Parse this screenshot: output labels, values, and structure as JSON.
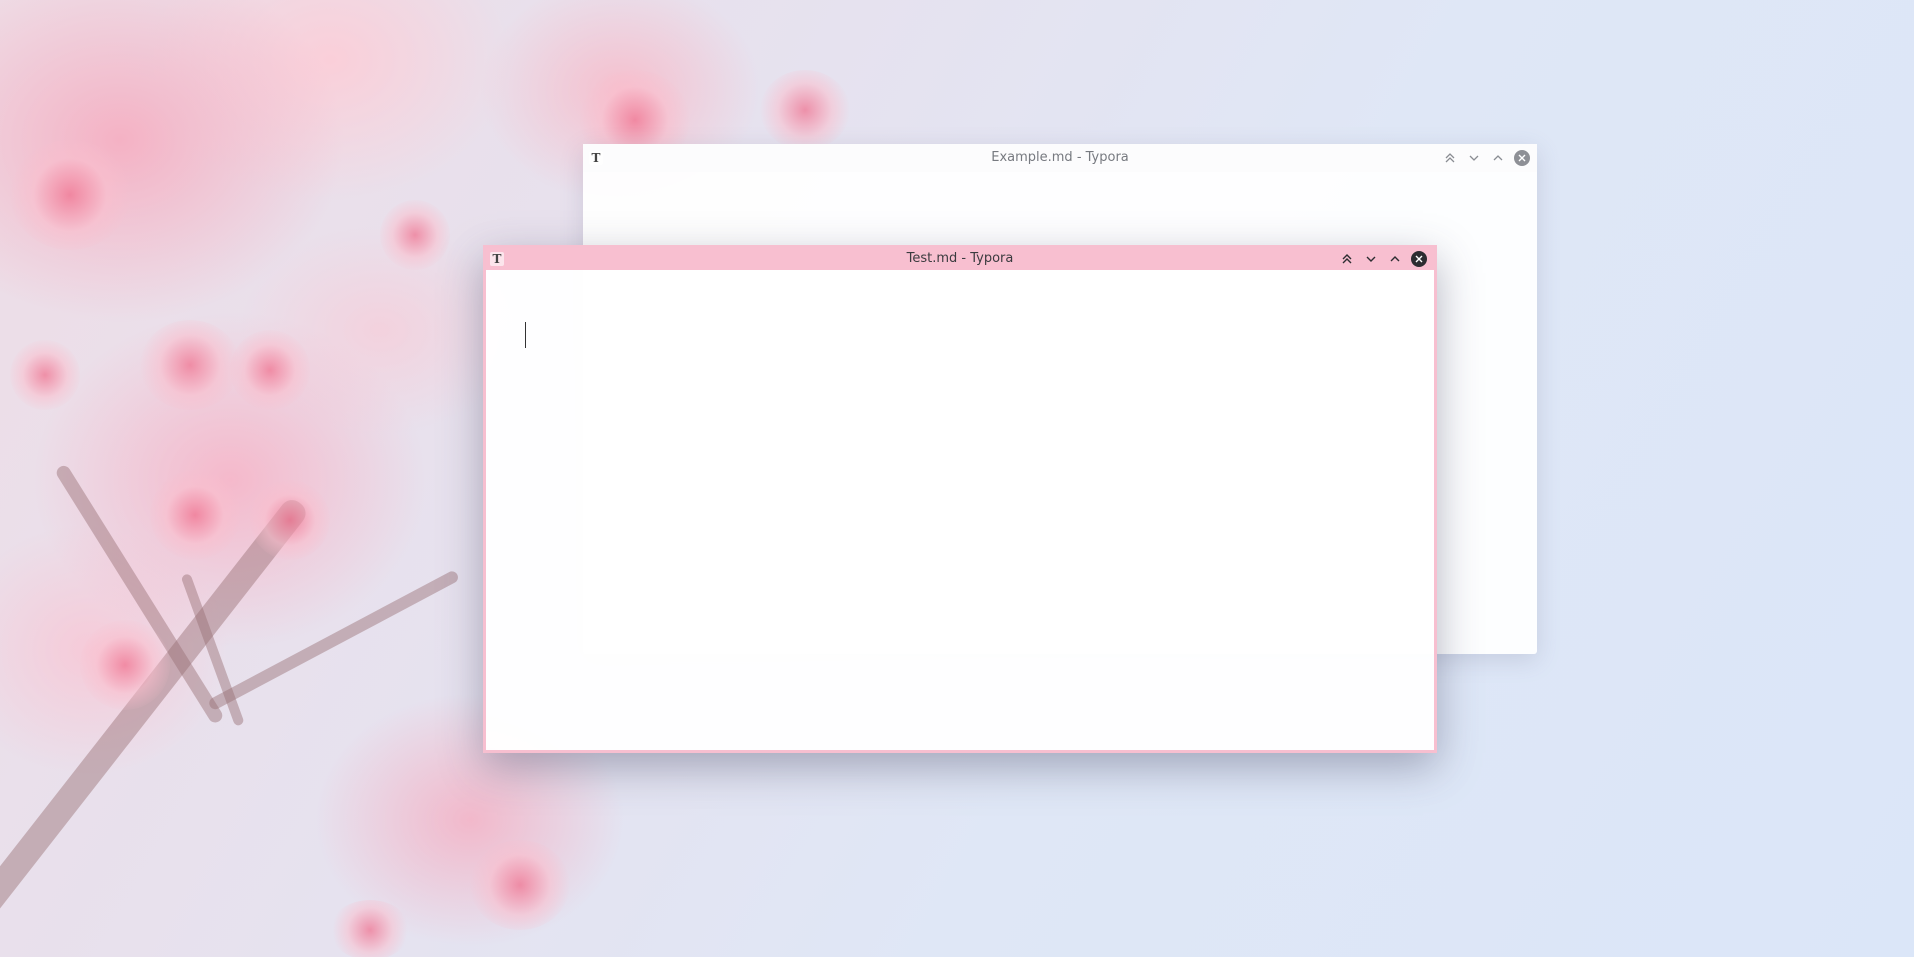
{
  "desktop": {
    "wallpaper": "cherry-blossom"
  },
  "windows": [
    {
      "id": "example",
      "title": "Example.md - Typora",
      "app_icon": "T",
      "state": "inactive"
    },
    {
      "id": "test",
      "title": "Test.md - Typora",
      "app_icon": "T",
      "state": "active",
      "accent_color": "#f8bfd0"
    }
  ],
  "controls": {
    "keep_above": "keep-above-icon",
    "minimize": "chevron-down-icon",
    "maximize": "chevron-up-icon",
    "close": "close-icon"
  }
}
